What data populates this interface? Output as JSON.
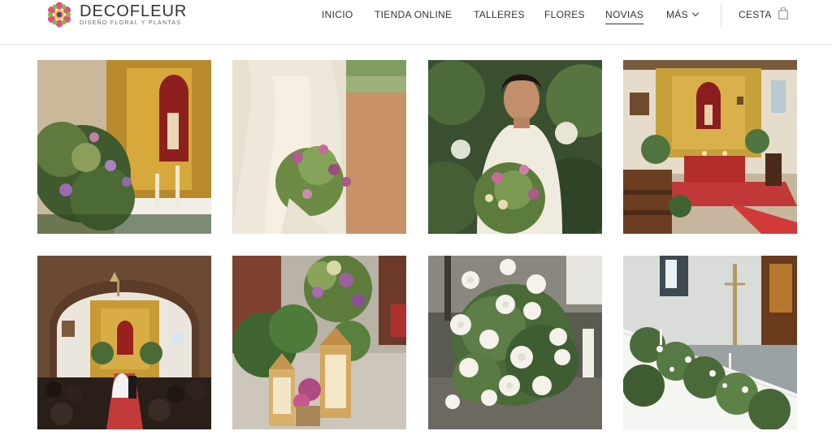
{
  "brand": {
    "name": "DECOFLEUR",
    "tagline": "DISEÑO FLORAL Y PLANTAS",
    "colors": {
      "petal_pink": "#e84a8a",
      "petal_green": "#7cbf3a",
      "center_purple": "#6a3d8f"
    }
  },
  "nav": {
    "items": [
      {
        "label": "INICIO"
      },
      {
        "label": "TIENDA ONLINE"
      },
      {
        "label": "TALLERES"
      },
      {
        "label": "FLORES"
      },
      {
        "label": "NOVIAS",
        "active": true
      },
      {
        "label": "MÁS"
      }
    ],
    "cart_label": "CESTA"
  },
  "gallery": {
    "tiles": [
      {
        "name": "altar-floral-arrangement"
      },
      {
        "name": "bride-bouquet-vintage-dress"
      },
      {
        "name": "bride-smiling-bouquet"
      },
      {
        "name": "church-interior-altar"
      },
      {
        "name": "wedding-ceremony-church"
      },
      {
        "name": "lanterns-plant-decor"
      },
      {
        "name": "white-roses-arrangement"
      },
      {
        "name": "table-garland-church"
      }
    ]
  }
}
